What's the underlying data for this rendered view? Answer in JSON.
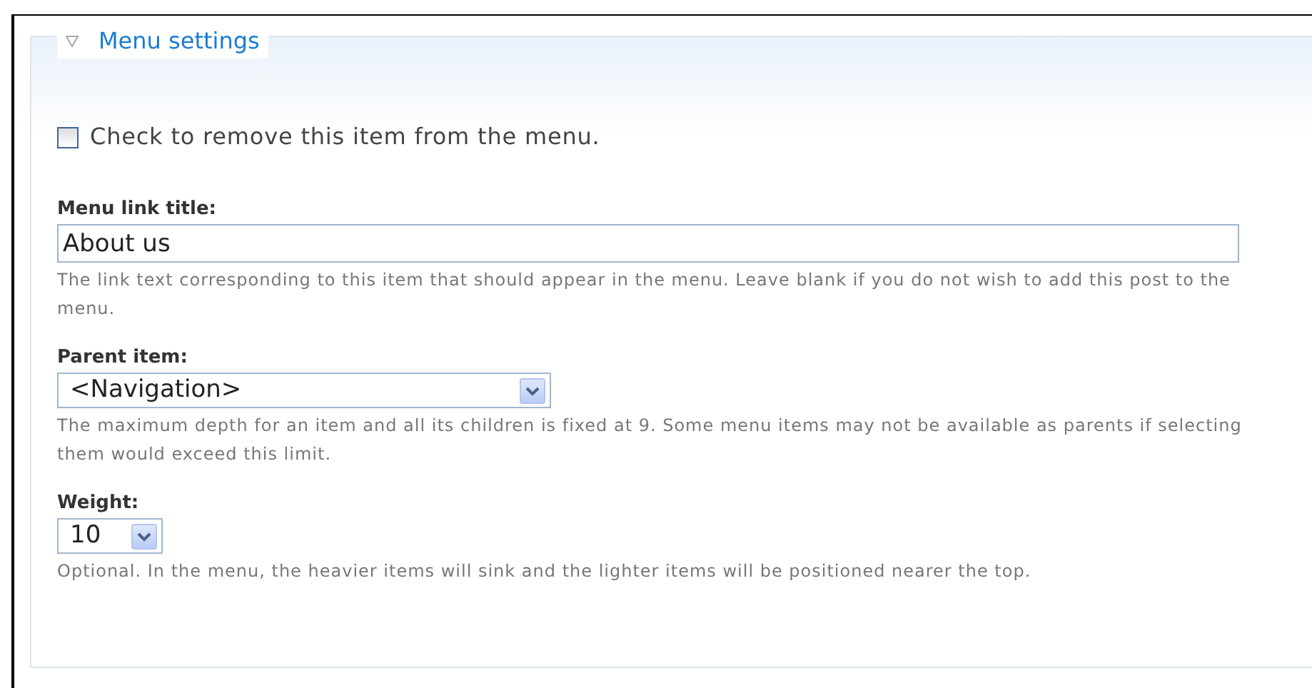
{
  "fieldset": {
    "legend": "Menu settings",
    "expanded": true
  },
  "remove_checkbox": {
    "label": "Check to remove this item from the menu.",
    "checked": false
  },
  "fields": [
    {
      "kind": "text",
      "label": "Menu link title:",
      "value": "About us",
      "description": "The link text corresponding to this item that should appear in the menu. Leave blank if you do not wish to add this post to the menu."
    },
    {
      "kind": "select",
      "label": "Parent item:",
      "value": "<Navigation>",
      "description": "The maximum depth for an item and all its children is fixed at 9. Some menu items may not be available as parents if selecting them would exceed this limit."
    },
    {
      "kind": "number",
      "label": "Weight:",
      "value": "10",
      "description": "Optional. In the menu, the heavier items will sink and the lighter items will be positioned nearer the top."
    }
  ]
}
